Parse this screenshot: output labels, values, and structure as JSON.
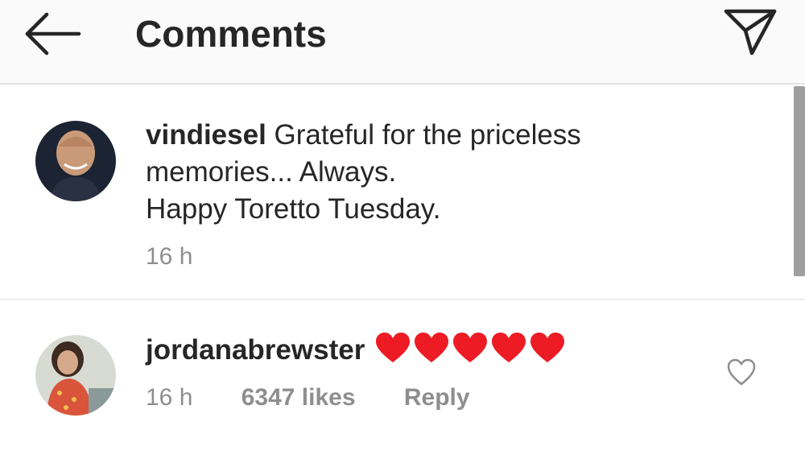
{
  "header": {
    "title": "Comments",
    "back_icon": "arrow-left-icon",
    "send_icon": "paper-plane-icon"
  },
  "caption": {
    "username": "vindiesel",
    "text_line1": "Grateful for the priceless",
    "text_line2": "memories... Always.",
    "text_line3": "Happy Toretto Tuesday.",
    "time": "16 h"
  },
  "comments": [
    {
      "username": "jordanabrewster",
      "emoji_count": 5,
      "emoji": "red-heart",
      "time": "16 h",
      "likes": "6347 likes",
      "reply_label": "Reply"
    }
  ],
  "colors": {
    "text": "#262626",
    "muted": "#8e8e8e",
    "heart": "#ed1c24",
    "header_bg": "#fafafa"
  }
}
